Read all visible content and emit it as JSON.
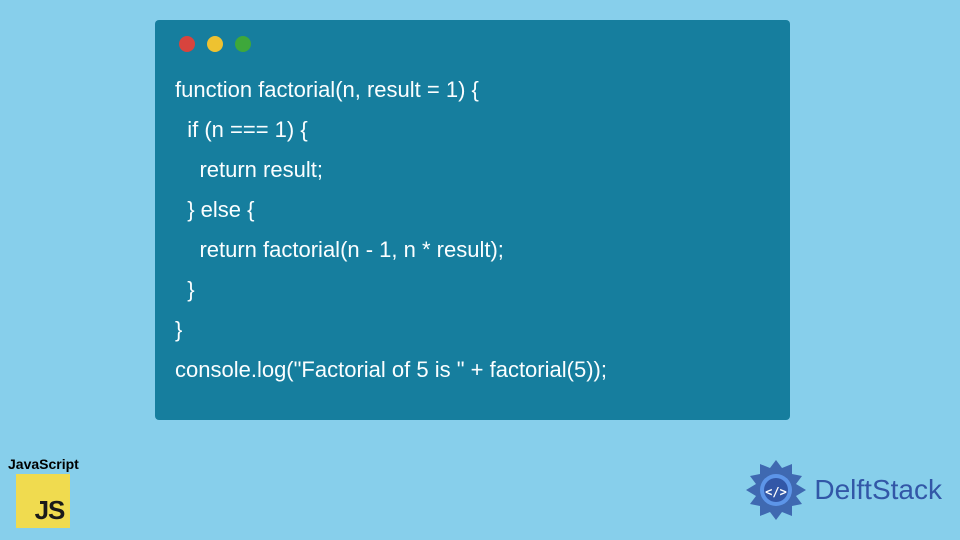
{
  "code": {
    "lines": [
      "function factorial(n, result = 1) {",
      "  if (n === 1) {",
      "    return result;",
      "  } else {",
      "    return factorial(n - 1, n * result);",
      "  }",
      "}",
      "console.log(\"Factorial of 5 is \" + factorial(5));"
    ]
  },
  "window": {
    "dots": [
      "red",
      "yellow",
      "green"
    ]
  },
  "badges": {
    "js_label": "JavaScript",
    "js_icon_text": "JS",
    "delft_text": "DelftStack"
  },
  "colors": {
    "page_bg": "#87cfeb",
    "window_bg": "#167e9e",
    "code_text": "#fbfeff",
    "dot_red": "#d7443e",
    "dot_yellow": "#eec230",
    "dot_green": "#3ea83b",
    "js_bg": "#f0db4f",
    "delft_accent": "#3257a7"
  }
}
